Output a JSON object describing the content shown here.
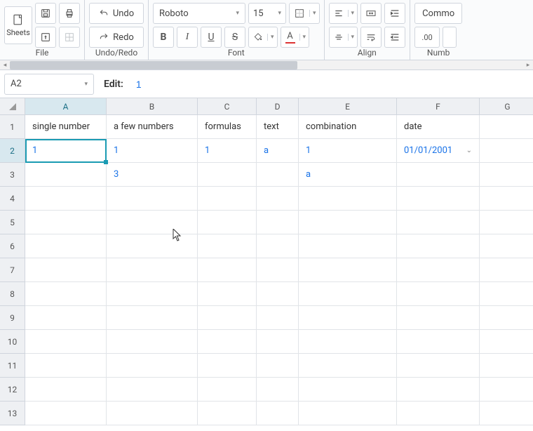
{
  "toolbar": {
    "sheets_label": "Sheets",
    "undo_label": "Undo",
    "redo_label": "Redo",
    "font_name": "Roboto",
    "font_size": "15",
    "format_btn": "Commo",
    "number_btn": ".00",
    "groups": {
      "file": "File",
      "undoredo": "Undo/Redo",
      "font": "Font",
      "align": "Align",
      "number": "Numb"
    }
  },
  "edit": {
    "cell_ref": "A2",
    "label": "Edit:",
    "value": "1"
  },
  "columns": [
    {
      "letter": "A",
      "width": 116
    },
    {
      "letter": "B",
      "width": 130
    },
    {
      "letter": "C",
      "width": 84
    },
    {
      "letter": "D",
      "width": 60
    },
    {
      "letter": "E",
      "width": 140
    },
    {
      "letter": "F",
      "width": 118
    },
    {
      "letter": "G",
      "width": 80
    }
  ],
  "rows": [
    "1",
    "2",
    "3",
    "4",
    "5",
    "6",
    "7",
    "8",
    "9",
    "10",
    "11",
    "12",
    "13"
  ],
  "cells": {
    "A1": "single number",
    "B1": "a few numbers",
    "C1": "formulas",
    "D1": "text",
    "E1": "combination",
    "F1": "date",
    "A2": "1",
    "B2": "1",
    "C2": "1",
    "D2": "a",
    "E2": "1",
    "F2": "01/01/2001",
    "B3": "3",
    "E3": "a"
  },
  "active_cell": "A2"
}
